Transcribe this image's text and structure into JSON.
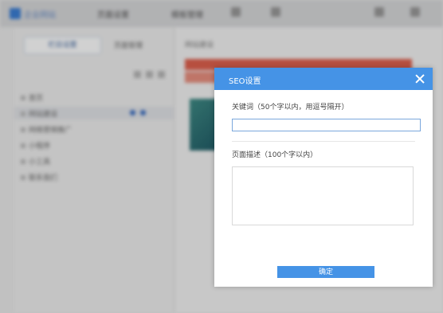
{
  "app": {
    "name": "企业网站",
    "toolbar": [
      "页面设置",
      "模板管理"
    ]
  },
  "sidebar": {
    "tab_active": "栏目设置",
    "tab_other": "页面管理",
    "nodes": [
      "首页",
      "网站建设",
      "网络营销推广",
      "小程序",
      "小工具",
      "联系我们"
    ]
  },
  "main": {
    "crumb": "网站建设"
  },
  "dialog": {
    "title": "SEO设置",
    "keywords_label": "关键词（50个字以内，用逗号隔开）",
    "keywords_value": "",
    "description_label": "页面描述（100个字以内）",
    "description_value": "",
    "confirm_label": "确定"
  },
  "colors": {
    "header": "#4593e6",
    "accent": "#4593e6"
  }
}
